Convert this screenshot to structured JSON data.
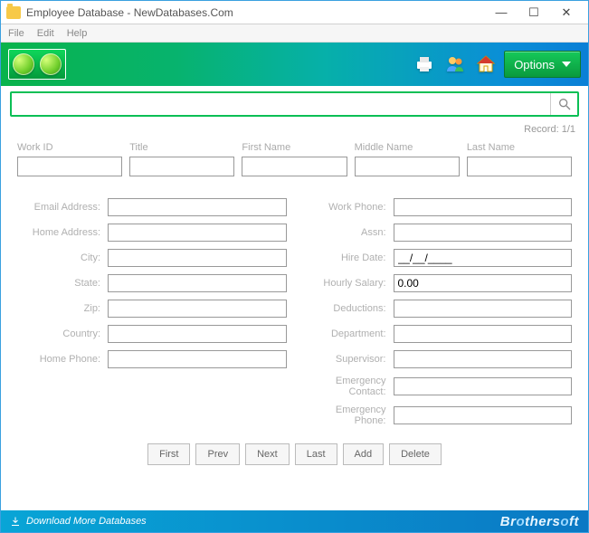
{
  "window": {
    "title": "Employee Database - NewDatabases.Com",
    "menu": [
      "File",
      "Edit",
      "Help"
    ]
  },
  "toolbar": {
    "options_label": "Options"
  },
  "page": {
    "record_label": "Record: 1/1"
  },
  "headers": {
    "work_id": "Work ID",
    "title": "Title",
    "first_name": "First Name",
    "middle_name": "Middle Name",
    "last_name": "Last Name"
  },
  "left_fields": {
    "email": "Email Address:",
    "home_address": "Home Address:",
    "city": "City:",
    "state": "State:",
    "zip": "Zip:",
    "country": "Country:",
    "home_phone": "Home Phone:"
  },
  "right_fields": {
    "work_phone": "Work Phone:",
    "assn": "Assn:",
    "hire_date": "Hire Date:",
    "hourly_salary": "Hourly Salary:",
    "deductions": "Deductions:",
    "department": "Department:",
    "supervisor": "Supervisor:",
    "emergency_contact": "Emergency Contact:",
    "emergency_phone": "Emergency Phone:"
  },
  "values": {
    "hire_date": "__/__/____",
    "hourly_salary": "0.00"
  },
  "nav": {
    "first": "First",
    "prev": "Prev",
    "next": "Next",
    "last": "Last",
    "add": "Add",
    "delete": "Delete"
  },
  "footer": {
    "download": "Download More Databases",
    "brand": "Brothersoft"
  }
}
